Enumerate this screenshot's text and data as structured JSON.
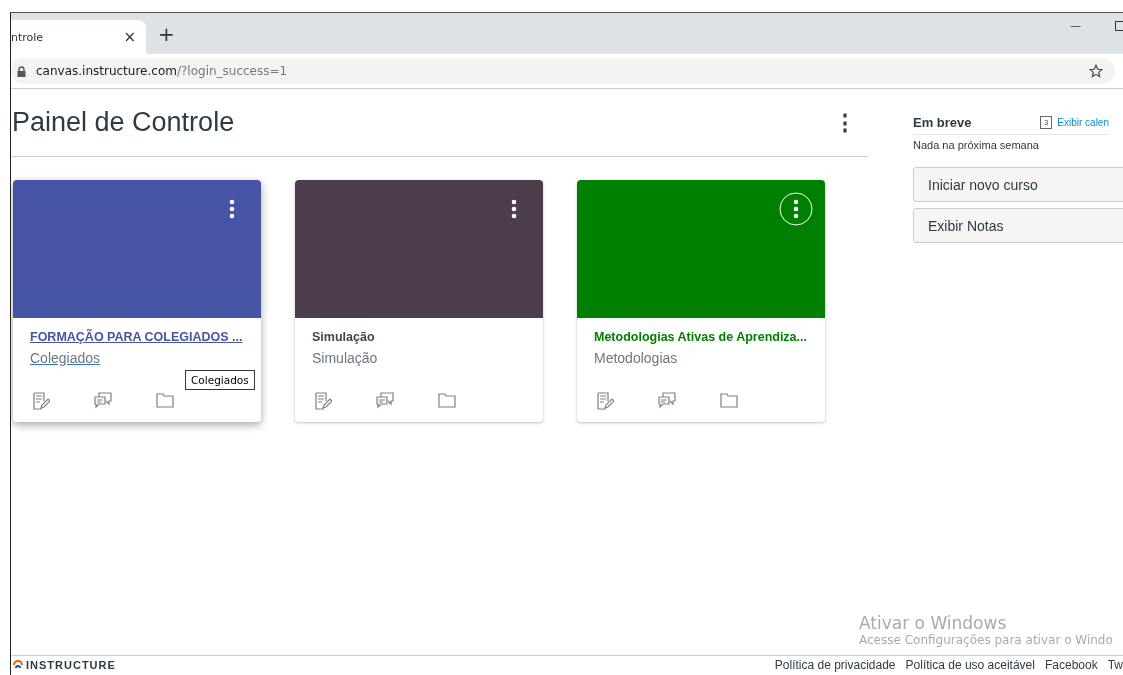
{
  "browser": {
    "tab_title": "ntrole",
    "tab_close": "×",
    "new_tab": "+",
    "minimize": "—",
    "url_host": "canvas.instructure.com",
    "url_path": "/?login_success=1"
  },
  "page": {
    "title": "Painel de Controle",
    "menu": "⋮"
  },
  "cards": [
    {
      "title": "FORMAÇÃO PARA COLEGIADOS ...",
      "subtitle": "Colegiados",
      "color": "#4554a4",
      "hovered": true,
      "menu_focused": false,
      "tooltip": "Colegiados"
    },
    {
      "title": "Simulação",
      "subtitle": "Simulação",
      "color": "#4e3d4d",
      "hovered": false,
      "menu_focused": false
    },
    {
      "title": "Metodologias Ativas de Aprendiza...",
      "subtitle": "Metodologias",
      "color": "#008000",
      "hovered": false,
      "menu_focused": true
    }
  ],
  "sidebar": {
    "heading": "Em breve",
    "calendar_link": "Exibir calen",
    "calendar_day": "3",
    "empty_text": "Nada na próxima semana",
    "buttons": [
      "Iniciar novo curso",
      "Exibir Notas"
    ]
  },
  "footer": {
    "logo": "INSTRUCTURE",
    "links": [
      "Política de privacidade",
      "Política de uso aceitável",
      "Facebook",
      "Tw"
    ]
  },
  "os_notice": {
    "title": "Ativar o Windows",
    "text": "Acesse Configurações para ativar o Windo"
  }
}
